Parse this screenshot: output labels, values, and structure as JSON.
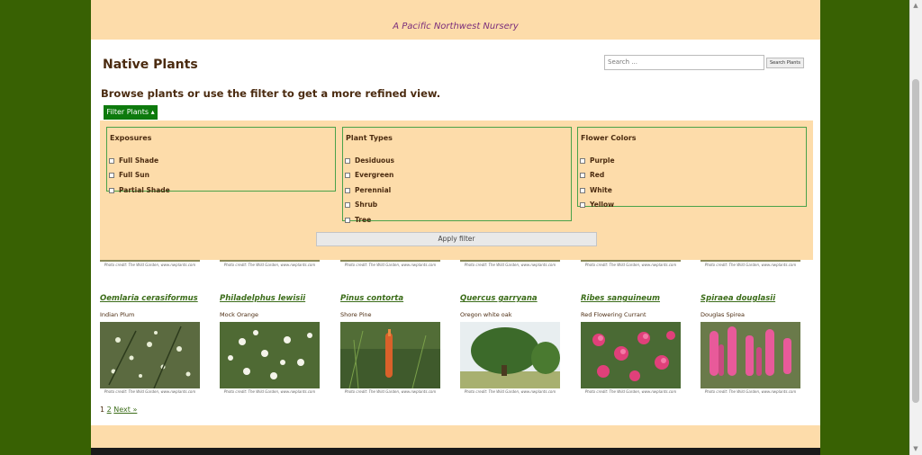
{
  "header": {
    "tagline": "A Pacific Northwest Nursery"
  },
  "page_title": "Native Plants",
  "search": {
    "placeholder": "Search ...",
    "button_label": "Search Plants"
  },
  "browse_text": "Browse plants or use the filter to get a more refined view.",
  "filter": {
    "toggle_label": "Filter Plants ▴",
    "apply_label": "Apply filter",
    "groups": [
      {
        "title": "Exposures",
        "options": [
          "Full Shade",
          "Full Sun",
          "Partial Shade"
        ]
      },
      {
        "title": "Plant Types",
        "options": [
          "Desiduous",
          "Evergreen",
          "Perennial",
          "Shrub",
          "Tree"
        ]
      },
      {
        "title": "Flower Colors",
        "options": [
          "Purple",
          "Red",
          "White",
          "Yellow"
        ]
      }
    ]
  },
  "photo_credit": "Photo credit: The Wild Garden, www.nwplants.com",
  "plants": [
    {
      "name": "Oemlaria cerasiformus",
      "common": "Indian Plum"
    },
    {
      "name": "Philadelphus lewisii",
      "common": "Mock Orange"
    },
    {
      "name": "Pinus contorta",
      "common": "Shore Pine"
    },
    {
      "name": "Quercus garryana",
      "common": "Oregon white oak"
    },
    {
      "name": "Ribes sanguineum",
      "common": "Red Flowering Currant"
    },
    {
      "name": "Spiraea douglasii",
      "common": "Douglas Spirea"
    }
  ],
  "pagination": {
    "page1": "1",
    "page2": "2",
    "next": "Next »"
  },
  "colors": {
    "background": "#386103",
    "header": "#fddcaa",
    "accent": "#0d7a0d",
    "link": "#3c6d1a"
  }
}
